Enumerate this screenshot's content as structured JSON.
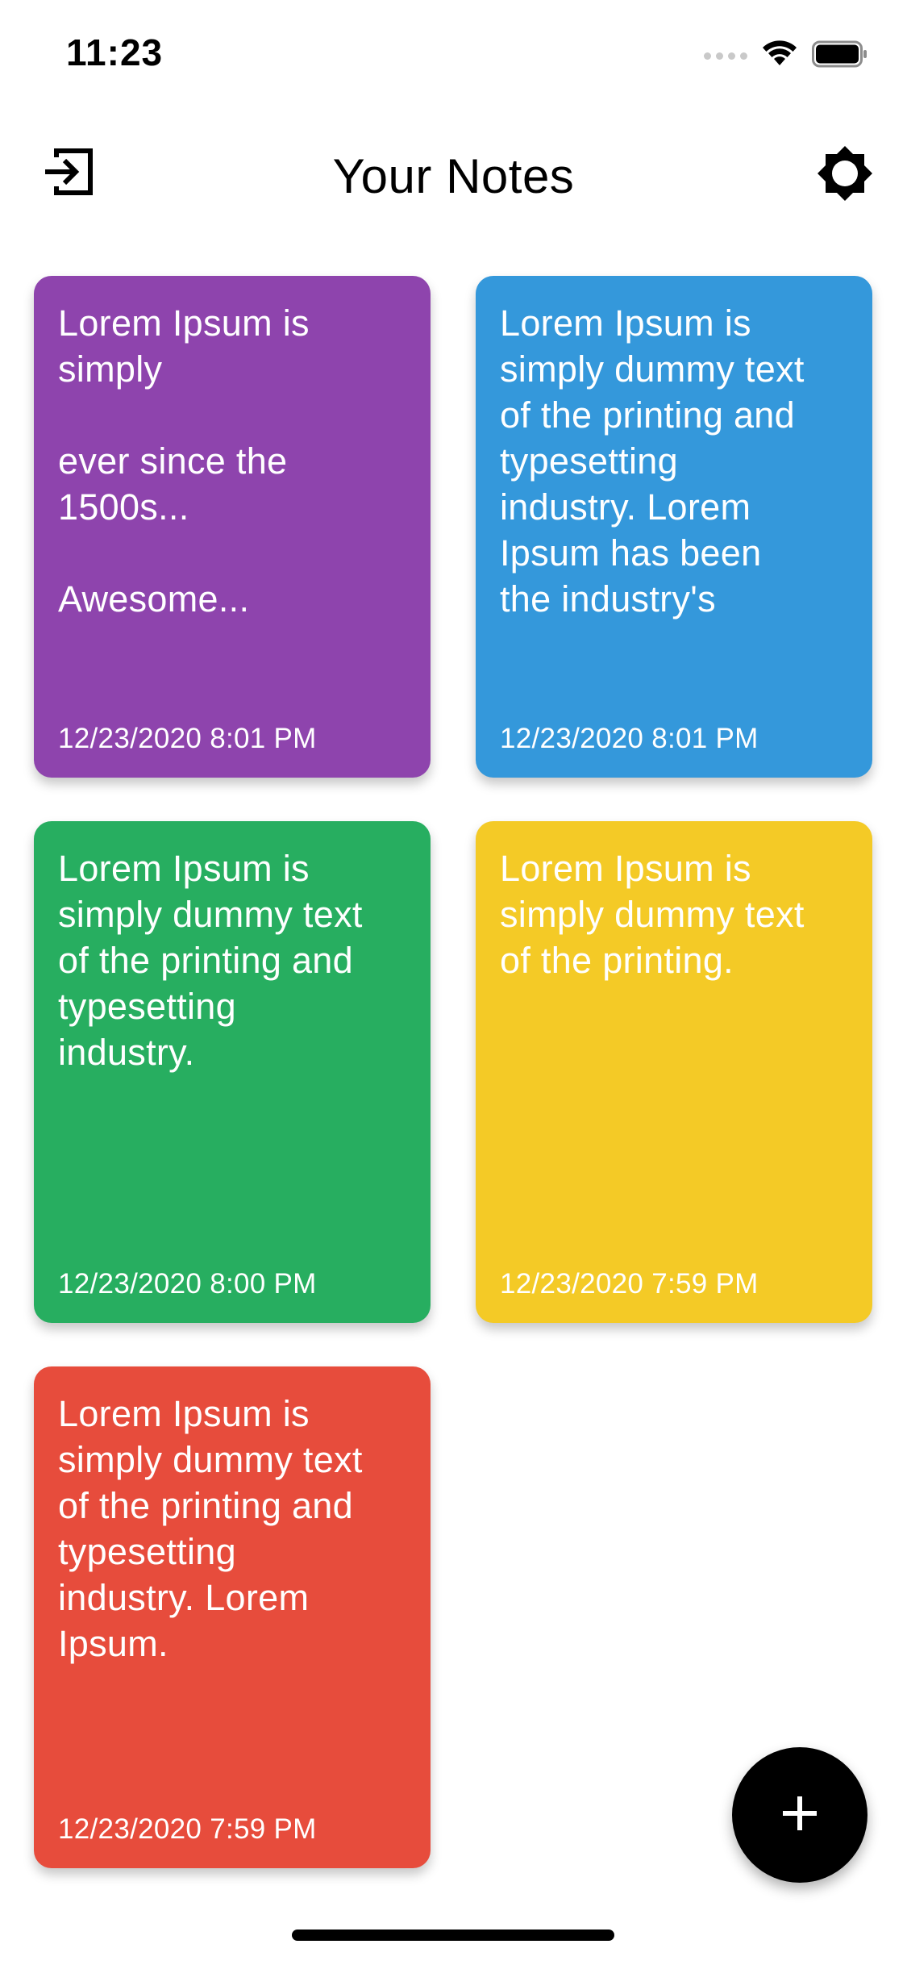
{
  "status_bar": {
    "time": "11:23"
  },
  "header": {
    "title": "Your Notes",
    "left_icon": "logout-icon",
    "right_icon": "brightness-icon"
  },
  "notes": [
    {
      "body": "Lorem Ipsum is\nsimply\n\never since the\n1500s...\n\nAwesome...",
      "date": "12/23/2020 8:01 PM",
      "color": "#8E44AD"
    },
    {
      "body": "Lorem Ipsum is\nsimply dummy text\nof the printing and\ntypesetting\nindustry. Lorem\nIpsum has been\nthe industry's",
      "date": "12/23/2020 8:01 PM",
      "color": "#3498DB"
    },
    {
      "body": "Lorem Ipsum is\nsimply dummy text\nof the printing and\ntypesetting\nindustry.",
      "date": "12/23/2020 8:00 PM",
      "color": "#27AE60"
    },
    {
      "body": "Lorem Ipsum is\nsimply dummy text\nof the printing.",
      "date": "12/23/2020 7:59 PM",
      "color": "#F4CA26"
    },
    {
      "body": "Lorem Ipsum is\nsimply dummy text\nof the printing and\ntypesetting\nindustry. Lorem\nIpsum.",
      "date": "12/23/2020 7:59 PM",
      "color": "#E74C3C"
    }
  ],
  "fab": {
    "icon": "plus-icon"
  }
}
